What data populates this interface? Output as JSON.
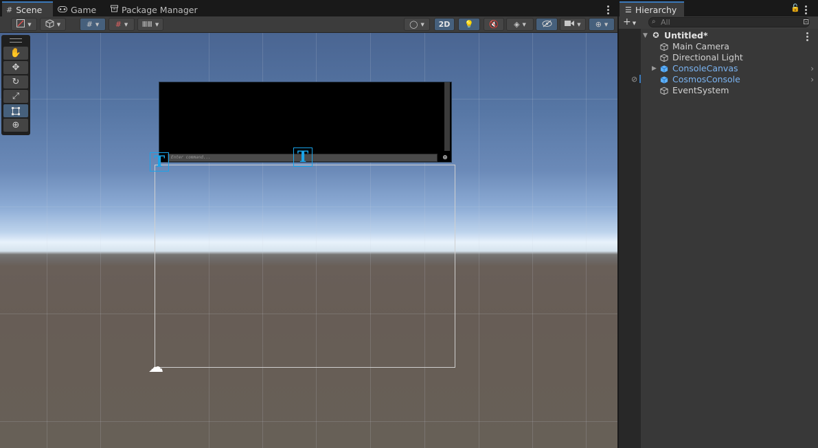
{
  "scene_window": {
    "tabs": [
      {
        "label": "Scene",
        "icon": "hash-icon"
      },
      {
        "label": "Game",
        "icon": "gamepad-icon"
      },
      {
        "label": "Package Manager",
        "icon": "package-icon"
      }
    ],
    "toolbar": {
      "mode_2d_label": "2D"
    },
    "console_input_placeholder": "Enter command...",
    "tool_palette": [
      "hand-tool",
      "move-tool",
      "rotate-tool",
      "scale-tool",
      "rect-tool",
      "transform-tool"
    ]
  },
  "hierarchy": {
    "tab_label": "Hierarchy",
    "search_placeholder": "All",
    "scene_name": "Untitled*",
    "items": [
      {
        "label": "Main Camera",
        "prefab": false
      },
      {
        "label": "Directional Light",
        "prefab": false
      },
      {
        "label": "ConsoleCanvas",
        "prefab": true
      },
      {
        "label": "CosmosConsole",
        "prefab": true
      },
      {
        "label": "EventSystem",
        "prefab": false
      }
    ]
  },
  "colors": {
    "accent": "#3a79bb",
    "prefab_text": "#7bb4f2",
    "gizmo": "#1ba4e8"
  }
}
